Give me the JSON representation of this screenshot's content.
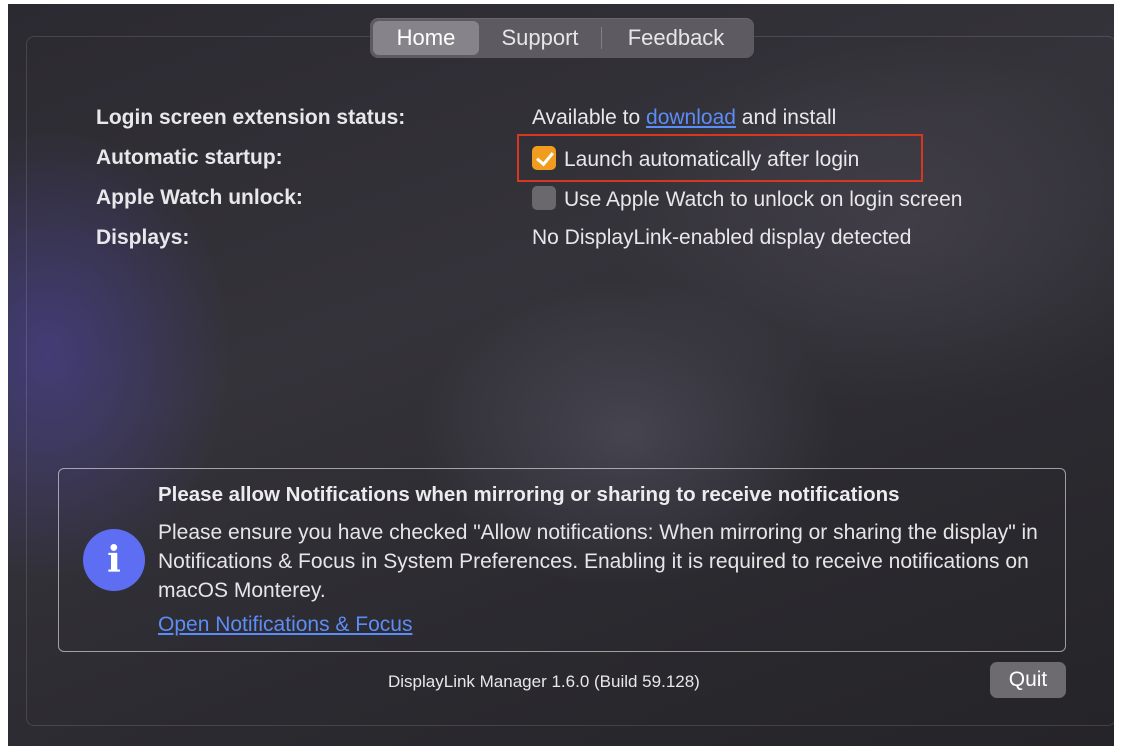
{
  "tabs": [
    {
      "label": "Home",
      "active": true
    },
    {
      "label": "Support",
      "active": false
    },
    {
      "label": "Feedback",
      "active": false
    }
  ],
  "settings": {
    "login_extension": {
      "label": "Login screen extension status:",
      "prefix": "Available to ",
      "link": "download",
      "suffix": " and install"
    },
    "auto_startup": {
      "label": "Automatic startup:",
      "checkbox_label": "Launch automatically after login",
      "checked": true
    },
    "apple_watch": {
      "label": "Apple Watch unlock:",
      "checkbox_label": "Use Apple Watch to unlock on login screen",
      "checked": false
    },
    "displays": {
      "label": "Displays:",
      "value": "No DisplayLink-enabled display detected"
    }
  },
  "notice": {
    "icon": "info-icon",
    "icon_glyph": "i",
    "title": "Please allow Notifications when mirroring or sharing to receive notifications",
    "body": "Please ensure you have checked \"Allow notifications: When mirroring or sharing the display\" in Notifications & Focus in System Preferences. Enabling it is required to receive notifications on macOS Monterey.",
    "link": "Open Notifications & Focus"
  },
  "footer": {
    "version": "DisplayLink Manager 1.6.0 (Build 59.128)",
    "quit_label": "Quit"
  },
  "colors": {
    "accent_checkbox": "#f29c1f",
    "link": "#5c8cf5",
    "info_icon": "#5d6ef2",
    "highlight_box": "#d6371f"
  }
}
